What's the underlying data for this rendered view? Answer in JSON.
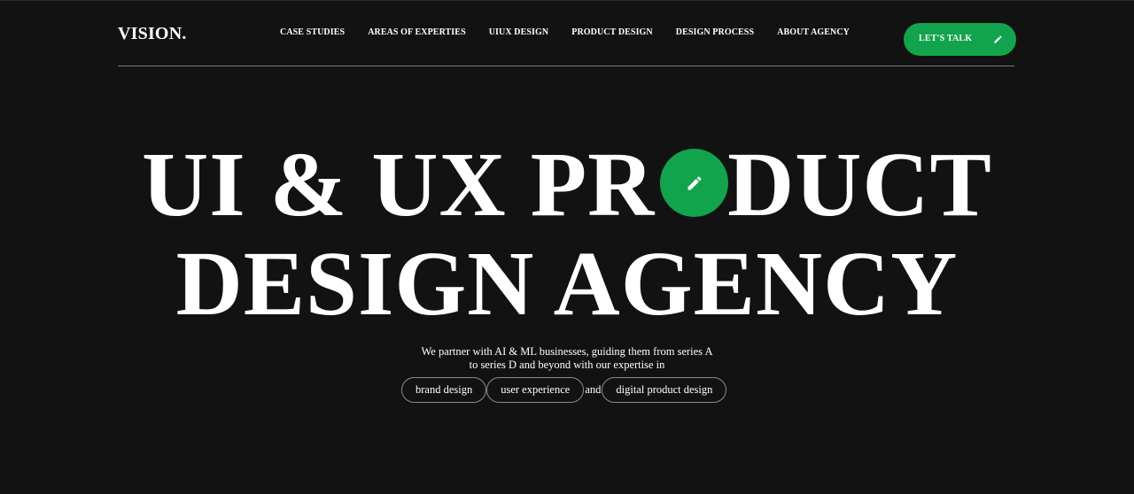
{
  "header": {
    "logo": "VISION.",
    "nav": [
      {
        "label": "CASE STUDIES"
      },
      {
        "label": "AREAS OF EXPERTIES"
      },
      {
        "label": "UIUX DESIGN"
      },
      {
        "label": "PRODUCT DESIGN"
      },
      {
        "label": "DESIGN PROCESS"
      },
      {
        "label": "ABOUT AGENCY"
      }
    ],
    "cta_label": "LET'S TALK",
    "cta_icon": "pencil-icon"
  },
  "hero": {
    "line1_before": "UI & UX PR",
    "line1_o": "O",
    "line1_after": "DUCT",
    "line2": "DESIGN AGENCY",
    "circle_icon": "pencil-icon"
  },
  "tagline": {
    "line1": "We partner with AI & ML businesses, guiding them from series A",
    "line2": "to series D and beyond with our expertise in"
  },
  "chips": {
    "brand": "brand design",
    "ux": "user experience",
    "and": "and",
    "digital": "digital product design"
  },
  "colors": {
    "background": "#121212",
    "accent": "#11a44c",
    "text": "#ffffff"
  }
}
